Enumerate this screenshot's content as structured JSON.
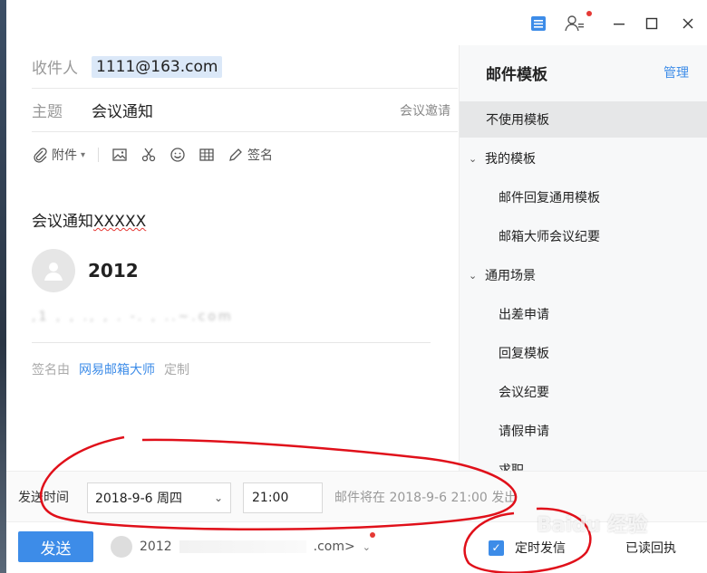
{
  "compose": {
    "to_label": "收件人",
    "to_value": "1111@163.com",
    "subject_label": "主题",
    "subject_value": "会议通知",
    "invite_link": "会议邀请",
    "toolbar": {
      "attach": "附件",
      "signature": "签名"
    },
    "body_prefix": "会议通知",
    "body_suffix": "XXXXX",
    "signature_name": "2012",
    "signature_blurred": ",1 , , .,  ,  .  -. , ..~.com",
    "signature_footer_prefix": "签名由",
    "signature_footer_brand": "网易邮箱大师",
    "signature_footer_customize": "定制"
  },
  "templates": {
    "title": "邮件模板",
    "manage": "管理",
    "items": [
      {
        "label": "不使用模板",
        "kind": "item0",
        "active": true
      },
      {
        "label": "我的模板",
        "kind": "group"
      },
      {
        "label": "邮件回复通用模板",
        "kind": "item1"
      },
      {
        "label": "邮箱大师会议纪要",
        "kind": "item1"
      },
      {
        "label": "通用场景",
        "kind": "group"
      },
      {
        "label": "出差申请",
        "kind": "item1"
      },
      {
        "label": "回复模板",
        "kind": "item1"
      },
      {
        "label": "会议纪要",
        "kind": "item1"
      },
      {
        "label": "请假申请",
        "kind": "item1"
      },
      {
        "label": "求职",
        "kind": "item1"
      }
    ]
  },
  "schedule": {
    "label": "发送时间",
    "date": "2018-9-6 周四",
    "time": "21:00",
    "note": "邮件将在 2018-9-6 21:00 发出"
  },
  "bottom": {
    "send": "发送",
    "sender_prefix": "2012",
    "sender_suffix": ".com>",
    "scheduled_send": "定时发信",
    "read_receipt": "已读回执"
  },
  "watermark": "Baidu 经验",
  "colors": {
    "accent": "#3d8ce8",
    "annotation": "#e0101a"
  }
}
